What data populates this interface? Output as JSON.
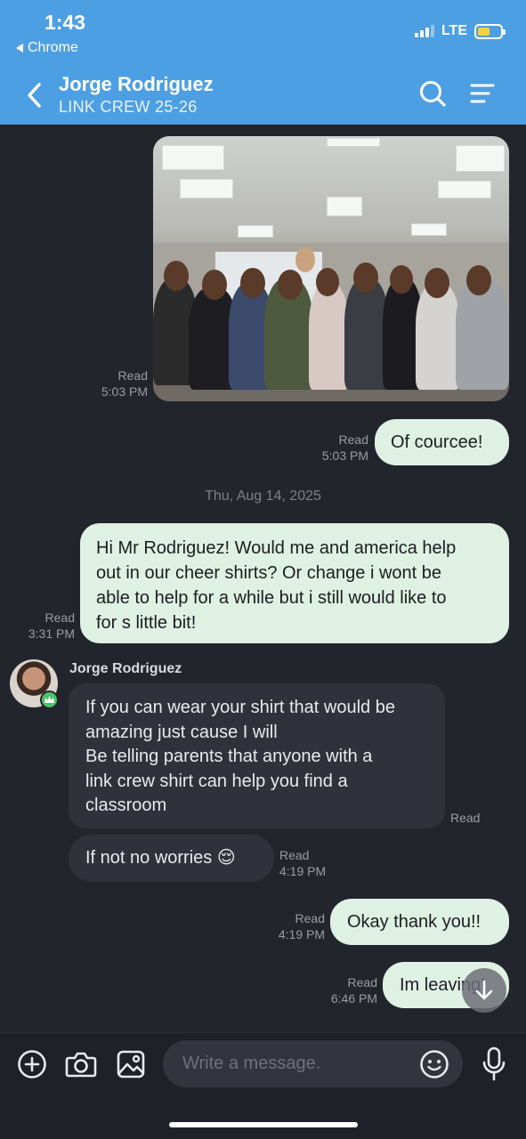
{
  "status": {
    "time": "1:43",
    "back_app": "Chrome",
    "network": "LTE"
  },
  "header": {
    "title": "Jorge Rodriguez",
    "subtitle": "LINK CREW 25-26"
  },
  "messages": {
    "photo_meta": {
      "status": "Read",
      "time": "5:03 PM"
    },
    "m1": {
      "text": "Of courcee!",
      "status": "Read",
      "time": "5:03 PM"
    },
    "date_separator": "Thu, Aug 14, 2025",
    "m2": {
      "lines": [
        "Hi Mr Rodriguez! Would me and america help",
        "out in our cheer shirts? Or change i wont be",
        "able to help for a while but i still would like to",
        "for s little bit!"
      ],
      "status": "Read",
      "time": "3:31 PM"
    },
    "sender_name": "Jorge Rodriguez",
    "m3": {
      "lines": [
        "If you can wear your shirt that would be",
        "amazing just cause I will",
        "Be telling parents  that anyone with a",
        "link crew shirt can help you find a",
        "classroom"
      ],
      "status": "Read"
    },
    "m4": {
      "text": "If not no worries 😌",
      "status": "Read",
      "time": "4:19 PM"
    },
    "m5": {
      "text": "Okay thank you!!",
      "status": "Read",
      "time": "4:19 PM"
    },
    "m6": {
      "text": "Im leaving!",
      "status": "Read",
      "time": "6:46 PM"
    }
  },
  "composer": {
    "placeholder": "Write a message."
  },
  "colors": {
    "header": "#4d9fe3",
    "background": "#23252d",
    "outgoing": "#dff1e3",
    "incoming": "#30323b"
  },
  "icons": [
    "chevron-left-icon",
    "search-icon",
    "menu-icon",
    "plus-icon",
    "camera-icon",
    "gallery-icon",
    "emoji-icon",
    "microphone-icon",
    "arrow-down-icon",
    "crown-icon"
  ]
}
